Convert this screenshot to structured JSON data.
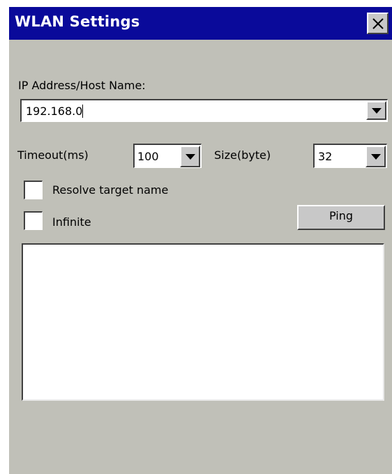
{
  "window": {
    "title": "WLAN Settings",
    "close_icon": "close-icon"
  },
  "form": {
    "ip_label": "IP Address/Host Name:",
    "ip_value": "192.168.0",
    "timeout_label": "Timeout(ms)",
    "timeout_value": "100",
    "size_label": "Size(byte)",
    "size_value": "32",
    "resolve_label": "Resolve target name",
    "resolve_checked": false,
    "infinite_label": "Infinite",
    "infinite_checked": false,
    "ping_label": "Ping",
    "output_text": ""
  },
  "colors": {
    "titlebar": "#0a0a9a",
    "window_bg": "#c0c0b8"
  }
}
